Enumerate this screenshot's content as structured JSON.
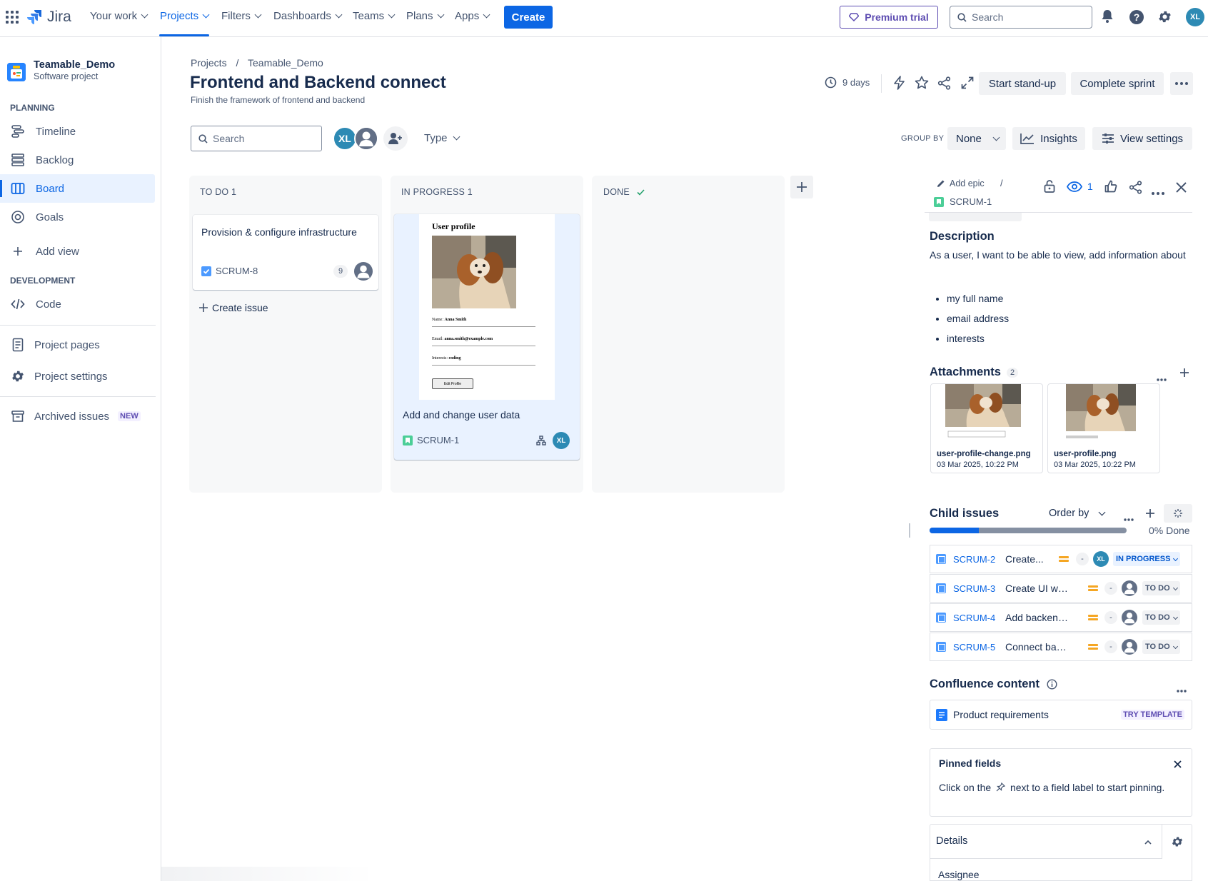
{
  "topnav": {
    "product": "Jira",
    "items": [
      "Your work",
      "Projects",
      "Filters",
      "Dashboards",
      "Teams",
      "Plans",
      "Apps"
    ],
    "create_label": "Create",
    "premium_label": "Premium trial",
    "search_placeholder": "Search",
    "user_initials": "XL"
  },
  "sidebar": {
    "project_name": "Teamable_Demo",
    "project_type": "Software project",
    "planning_label": "PLANNING",
    "planning_items": [
      "Timeline",
      "Backlog",
      "Board",
      "Goals"
    ],
    "add_view": "Add view",
    "development_label": "DEVELOPMENT",
    "code": "Code",
    "project_pages": "Project pages",
    "project_settings": "Project settings",
    "archived_issues": "Archived issues",
    "new_badge": "NEW"
  },
  "header": {
    "breadcrumb_projects": "Projects",
    "breadcrumb_separator": "/",
    "breadcrumb_project": "Teamable_Demo",
    "title": "Frontend and Backend connect",
    "subtitle": "Finish the framework of frontend and backend",
    "days": "9 days",
    "start_standup": "Start stand-up",
    "complete_sprint": "Complete sprint"
  },
  "toolbar": {
    "search_placeholder": "Search",
    "avatar_initials": "XL",
    "type_label": "Type",
    "group_by_label": "GROUP BY",
    "group_by_value": "None",
    "insights": "Insights",
    "view_settings": "View settings"
  },
  "board": {
    "columns": [
      {
        "title": "TO DO 1"
      },
      {
        "title": "IN PROGRESS 1"
      },
      {
        "title": "DONE"
      }
    ],
    "todo_card": {
      "title": "Provision & configure infrastructure",
      "key": "SCRUM-8",
      "count": "9"
    },
    "create_issue": "Create issue",
    "progress_card": {
      "title": "Add and change user data",
      "key": "SCRUM-1",
      "assignee": "XL",
      "mock": {
        "heading": "User profile",
        "name_label": "Name:",
        "name_value": "Anna Smith",
        "email_label": "Email:",
        "email_value": "anna.smith@example.com",
        "interests_label": "Interests:",
        "interests_value": "coding",
        "button": "Edit Profile"
      }
    }
  },
  "panel": {
    "add_epic": "Add epic",
    "separator": "/",
    "issue_key": "SCRUM-1",
    "watch_count": "1",
    "description_title": "Description",
    "description_text": "As a user, I want to be able to view, add information about",
    "description_items": [
      "my full name",
      "email address",
      "interests"
    ],
    "attachments_title": "Attachments",
    "attachments_count": "2",
    "attachments": [
      {
        "name": "user-profile-change.png",
        "date": "03 Mar 2025, 10:22 PM"
      },
      {
        "name": "user-profile.png",
        "date": "03 Mar 2025, 10:22 PM"
      }
    ],
    "child_title": "Child issues",
    "order_by": "Order by",
    "progress_done": "0% Done",
    "children": [
      {
        "key": "SCRUM-2",
        "title": "Create...",
        "dash": "-",
        "assignee": "XL",
        "status": "IN PROGRESS"
      },
      {
        "key": "SCRUM-3",
        "title": "Create UI wit...",
        "dash": "-",
        "assignee": "",
        "status": "TO DO"
      },
      {
        "key": "SCRUM-4",
        "title": "Add backend...",
        "dash": "-",
        "assignee": "",
        "status": "TO DO"
      },
      {
        "key": "SCRUM-5",
        "title": "Connect bac...",
        "dash": "-",
        "assignee": "",
        "status": "TO DO"
      }
    ],
    "confluence_title": "Confluence content",
    "product_requirements": "Product requirements",
    "try_template": "TRY TEMPLATE",
    "pinned_title": "Pinned fields",
    "pinned_text_before": "Click on the",
    "pinned_text_after": "next to a field label to start pinning.",
    "details": "Details",
    "assignee": "Assignee"
  },
  "colors": {
    "accent": "#0c66e4",
    "premium": "#5e4db2",
    "progress": "#0c66e4",
    "prio": "#f5a623"
  }
}
